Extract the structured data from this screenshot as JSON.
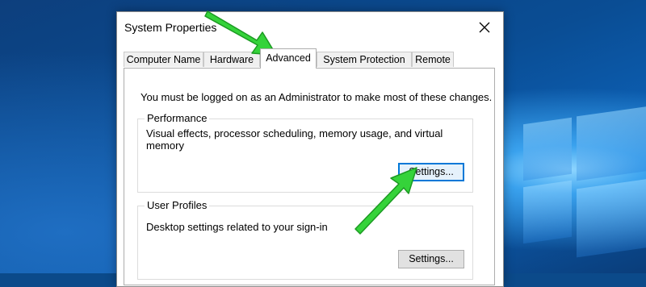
{
  "dialog": {
    "title": "System Properties",
    "close_icon": "close-icon"
  },
  "tabs": [
    {
      "label": "Computer Name",
      "active": false
    },
    {
      "label": "Hardware",
      "active": false
    },
    {
      "label": "Advanced",
      "active": true
    },
    {
      "label": "System Protection",
      "active": false
    },
    {
      "label": "Remote",
      "active": false
    }
  ],
  "advanced": {
    "notice": "You must be logged on as an Administrator to make most of these changes.",
    "performance": {
      "label": "Performance",
      "description": "Visual effects, processor scheduling, memory usage, and virtual memory",
      "button": "Settings..."
    },
    "user_profiles": {
      "label": "User Profiles",
      "description": "Desktop settings related to your sign-in",
      "button": "Settings..."
    }
  },
  "annotations": {
    "arrow_color": "#2ecc40",
    "arrow_icons": [
      "arrow-to-advanced-tab",
      "arrow-to-performance-settings"
    ]
  },
  "desktop": {
    "wallpaper": "windows-10-hero-wallpaper",
    "accent": "#0b4a8a"
  }
}
